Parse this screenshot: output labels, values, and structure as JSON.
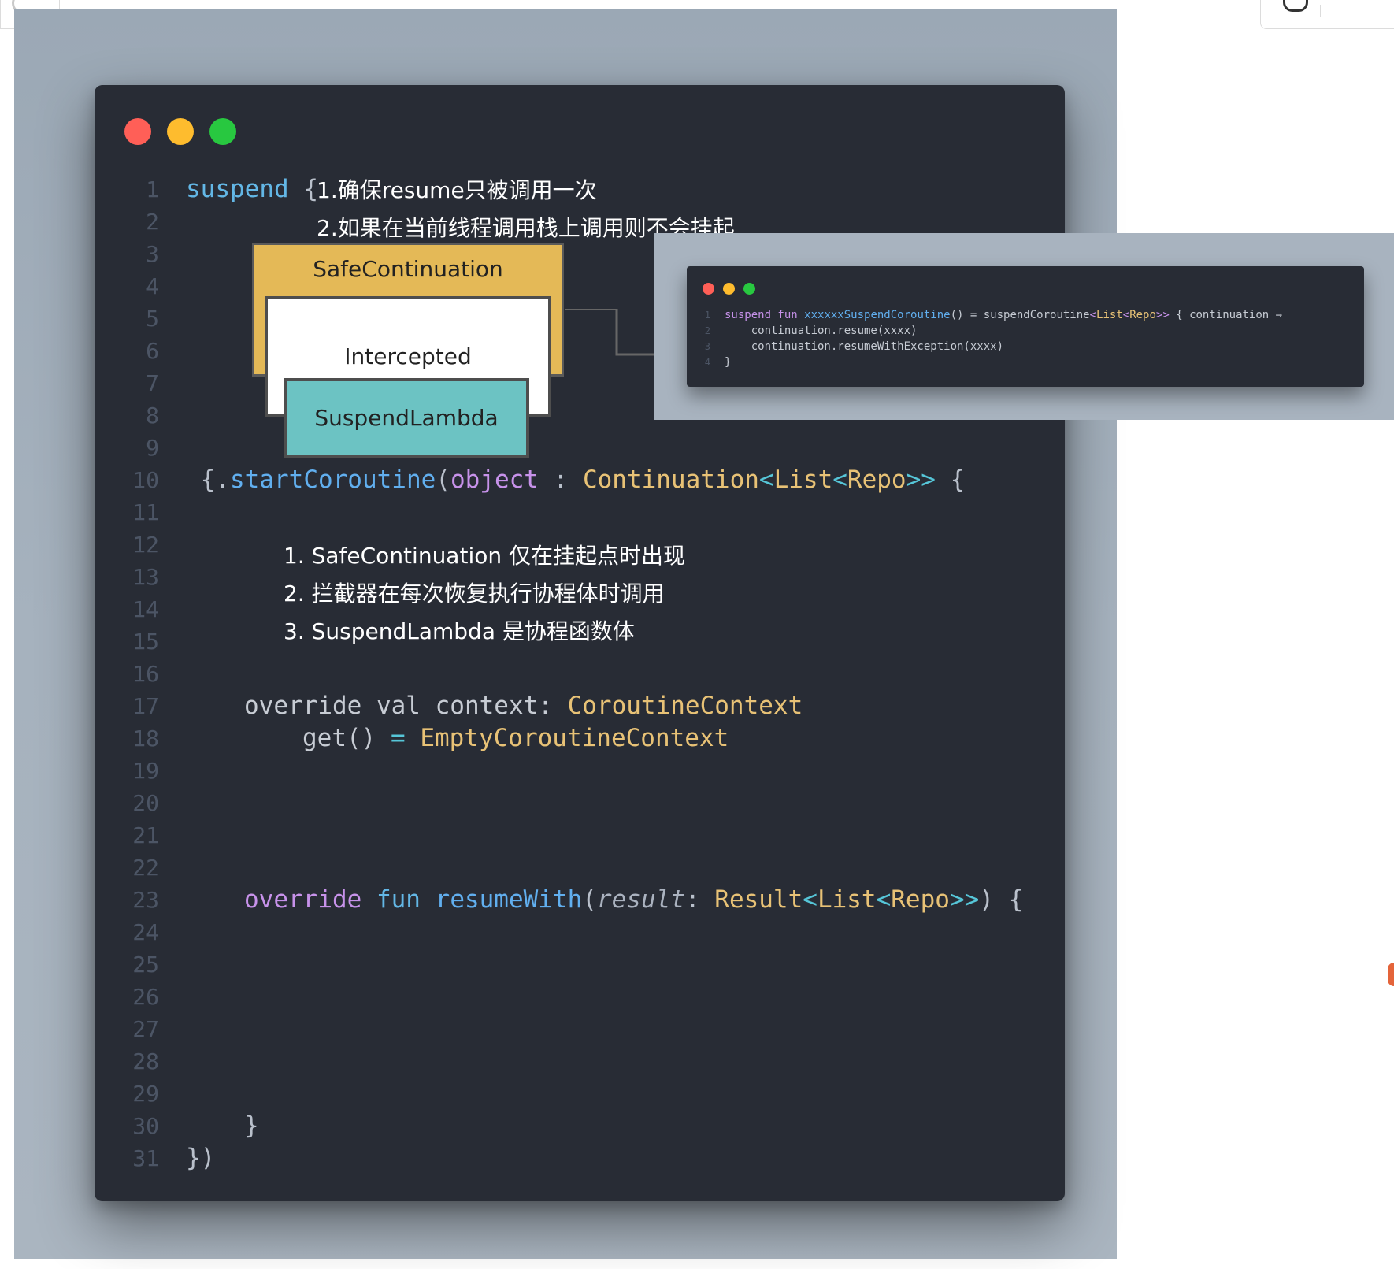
{
  "window": {
    "traffic_lights": {
      "close": "#ff5f57",
      "minimize": "#febc2e",
      "zoom": "#28c840"
    }
  },
  "editor": {
    "line_numbers": [
      "1",
      "2",
      "3",
      "4",
      "5",
      "6",
      "7",
      "8",
      "9",
      "10",
      "11",
      "12",
      "13",
      "14",
      "15",
      "16",
      "17",
      "18",
      "19",
      "20",
      "21",
      "22",
      "23",
      "24",
      "25",
      "26",
      "27",
      "28",
      "29",
      "30",
      "31"
    ],
    "line1": {
      "keyword": "suspend",
      "brace": "{"
    },
    "line10": {
      "brace": " {",
      "dot": ".",
      "fn": "startCoroutine",
      "paren": "(",
      "kw": "object",
      "colon": " : ",
      "type1": "Continuation",
      "lt1": "<",
      "type2": "List",
      "lt2": "<",
      "type3": "Repo",
      "gt": ">>"
    },
    "line17": {
      "text": "override val context: ",
      "type": "CoroutineContext"
    },
    "line18": {
      "text": "get() ",
      "eq": "=",
      "type": "EmptyCoroutineContext"
    },
    "line23": {
      "kw1": "override",
      "kw2": "fun",
      "fn": "resumeWith",
      "paren": "(",
      "param": "result",
      "colon": ": ",
      "type1": "Result",
      "lt1": "<",
      "type2": "List",
      "lt2": "<",
      "type3": "Repo",
      "gt": ">>",
      "close": ") {"
    },
    "line30": {
      "brace": "}"
    },
    "line31": {
      "text": "})"
    }
  },
  "annotations": {
    "top_note_1": "1.确保resume只被调用一次",
    "top_note_2": "2.如果在当前线程调用栈上调用则不会挂起",
    "list_1": "1. SafeContinuation 仅在挂起点时出现",
    "list_2": "2. 拦截器在每次恢复执行协程体时调用",
    "list_3": "3. SuspendLambda 是协程函数体"
  },
  "diagram": {
    "safe_continuation": "SafeContinuation",
    "intercepted": "Intercepted",
    "suspend_lambda": "SuspendLambda",
    "colors": {
      "safe": "#e4b957",
      "intercepted": "#ffffff",
      "suspend": "#6cc3c3"
    }
  },
  "popup": {
    "line_numbers": [
      "1",
      "2",
      "3",
      "4"
    ],
    "line1": {
      "kw": "suspend fun ",
      "fn": "xxxxxxSuspendCoroutine",
      "mid": "() = suspendCoroutine",
      "lt": "<",
      "type1": "List",
      "lt2": "<",
      "type2": "Repo",
      "gt": ">>",
      "rest": " { continuation →"
    },
    "line2": "    continuation.resume(xxxx)",
    "line3": "    continuation.resumeWithException(xxxx)",
    "line4": "}"
  }
}
